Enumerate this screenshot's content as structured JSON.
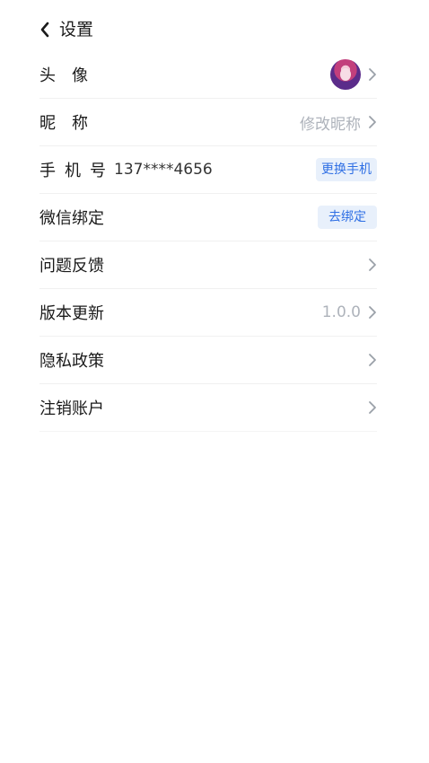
{
  "header": {
    "title": "设置"
  },
  "rows": [
    {
      "label": "头　像"
    },
    {
      "label": "昵　称",
      "value": "修改昵称"
    },
    {
      "label": "手机号",
      "phone": "137****4656",
      "action": "更换手机"
    },
    {
      "label": "微信绑定",
      "action": "去绑定"
    },
    {
      "label": "问题反馈"
    },
    {
      "label": "版本更新",
      "value": "1.0.0"
    },
    {
      "label": "隐私政策"
    },
    {
      "label": "注销账户"
    }
  ],
  "colors": {
    "accent": "#2f6fe4",
    "pill_bg": "#e8f0fb",
    "muted": "#aeb3bb"
  }
}
